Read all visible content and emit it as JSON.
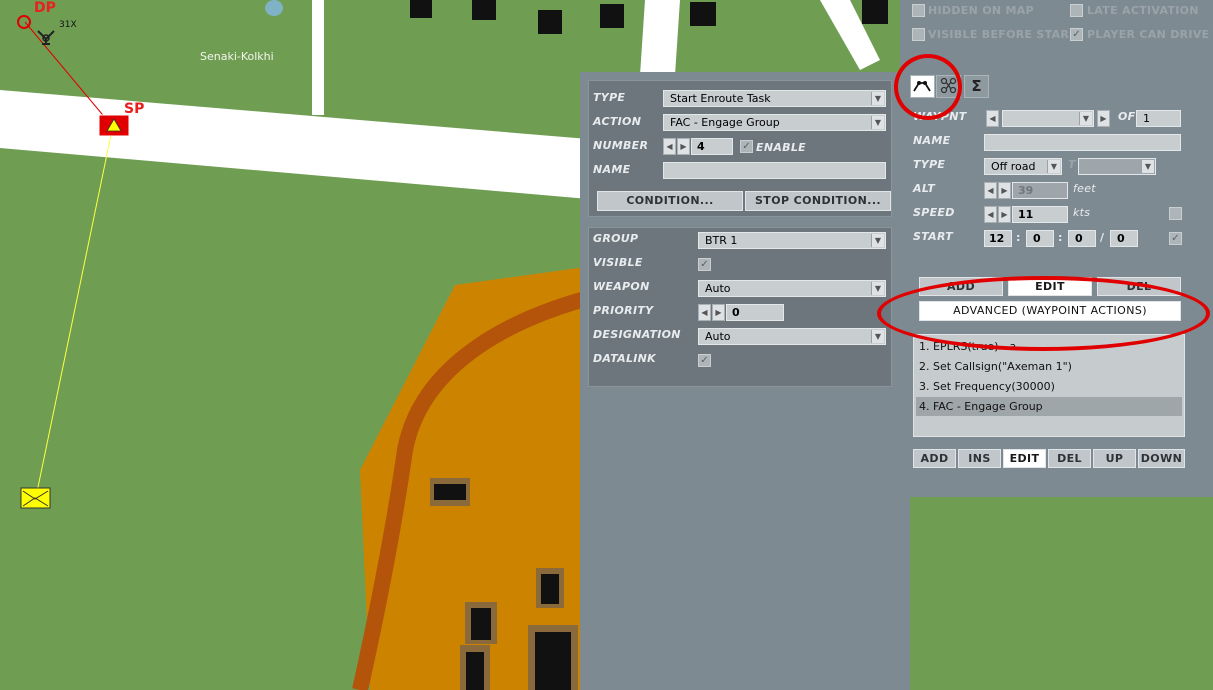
{
  "map": {
    "town_label": "Senaki-Kolkhi",
    "marker_dp": "DP",
    "marker_sp": "SP",
    "marker_31x": "31X"
  },
  "top_checks": {
    "hidden_on_map": "HIDDEN ON MAP",
    "late_activation": "LATE ACTIVATION",
    "visible_before_start": "VISIBLE BEFORE STAR",
    "player_can_drive": "PLAYER CAN DRIVE"
  },
  "task": {
    "type_label": "TYPE",
    "type_value": "Start Enroute Task",
    "action_label": "ACTION",
    "action_value": "FAC - Engage Group",
    "number_label": "NUMBER",
    "number_value": "4",
    "enable_label": "ENABLE",
    "name_label": "NAME",
    "name_value": "",
    "condition_button": "CONDITION...",
    "stop_condition_button": "STOP CONDITION..."
  },
  "params": {
    "group_label": "GROUP",
    "group_value": "BTR 1",
    "visible_label": "VISIBLE",
    "weapon_label": "WEAPON",
    "weapon_value": "Auto",
    "priority_label": "PRIORITY",
    "priority_value": "0",
    "designation_label": "DESIGNATION",
    "designation_value": "Auto",
    "datalink_label": "DATALINK"
  },
  "route": {
    "tab_sigma": "Σ",
    "waypoint_label": "WAYPNT",
    "of_label": "OF",
    "of_value": "1",
    "name_label": "NAME",
    "type_label": "TYPE",
    "type_value": "Off road",
    "type2_label": "T",
    "alt_label": "ALT",
    "alt_value": "39",
    "alt_unit": "feet",
    "speed_label": "SPEED",
    "speed_value": "11",
    "speed_unit": "kts",
    "start_label": "START",
    "start_h": "12",
    "start_m": "0",
    "start_s": "0",
    "start_d": "0",
    "sep1": ":",
    "sep2": ":",
    "sep3": "/",
    "add_button": "ADD",
    "edit_button": "EDIT",
    "del_button": "DEL",
    "advanced_button": "ADVANCED (WAYPOINT ACTIONS)",
    "actions": [
      "1. EPLRS(true) - a",
      "2. Set Callsign(\"Axeman 1\")",
      "3. Set Frequency(30000)",
      "4. FAC - Engage Group"
    ],
    "bottom_buttons": {
      "add": "ADD",
      "ins": "INS",
      "edit": "EDIT",
      "del": "DEL",
      "up": "UP",
      "down": "DOWN"
    }
  },
  "colors": {
    "grass": "#6f9e53",
    "road": "#ffffff",
    "industrial": "#cc8400",
    "rail": "#b3540a",
    "panel": "#7e8a91",
    "highlight": "#e00000"
  }
}
